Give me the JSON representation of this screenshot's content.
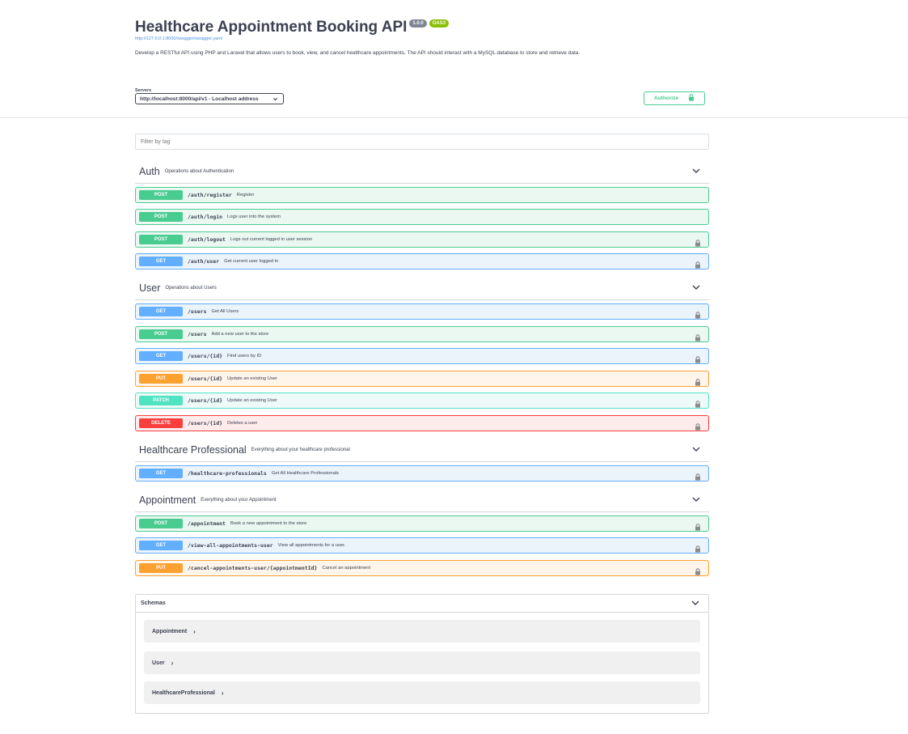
{
  "info": {
    "title": "Healthcare Appointment Booking API",
    "version": "1.0.0",
    "oas": "OAS3",
    "spec_url": "http://127.0.0.1:8000/swagger/swagger.yaml",
    "description": "Develop a RESTful API using PHP and Laravel that allows users to book, view, and cancel healthcare appointments. The API should interact with a MySQL database to store and retrieve data."
  },
  "servers": {
    "label": "Servers",
    "selected": "http://localhost:8000/api/v1 - Localhost address"
  },
  "authorize": {
    "label": "Authorize"
  },
  "filter": {
    "placeholder": "Filter by tag"
  },
  "tags": [
    {
      "name": "Auth",
      "description": "Operations about Authentication",
      "ops": [
        {
          "method": "POST",
          "path": "/auth/register",
          "summary": "Register",
          "locked": false
        },
        {
          "method": "POST",
          "path": "/auth/login",
          "summary": "Logs user into the system",
          "locked": false
        },
        {
          "method": "POST",
          "path": "/auth/logout",
          "summary": "Logs out current logged in user session",
          "locked": true
        },
        {
          "method": "GET",
          "path": "/auth/user",
          "summary": "Get current user logged in",
          "locked": true
        }
      ]
    },
    {
      "name": "User",
      "description": "Operations about Users",
      "ops": [
        {
          "method": "GET",
          "path": "/users",
          "summary": "Get All Users",
          "locked": true
        },
        {
          "method": "POST",
          "path": "/users",
          "summary": "Add a new user to the store",
          "locked": true
        },
        {
          "method": "GET",
          "path": "/users/{id}",
          "summary": "Find users by ID",
          "locked": true
        },
        {
          "method": "PUT",
          "path": "/users/{id}",
          "summary": "Update an existing User",
          "locked": true
        },
        {
          "method": "PATCH",
          "path": "/users/{id}",
          "summary": "Update an existing User",
          "locked": true
        },
        {
          "method": "DELETE",
          "path": "/users/{id}",
          "summary": "Deletes a user",
          "locked": true
        }
      ]
    },
    {
      "name": "Healthcare Professional",
      "description": "Everything about your healthcare professional",
      "ops": [
        {
          "method": "GET",
          "path": "/healthcare-professionals",
          "summary": "Get All Healthcare Professionals",
          "locked": true
        }
      ]
    },
    {
      "name": "Appointment",
      "description": "Everything about your Appointment",
      "ops": [
        {
          "method": "POST",
          "path": "/appointment",
          "summary": "Book a new appointment to the store",
          "locked": true
        },
        {
          "method": "GET",
          "path": "/view-all-appointments-user",
          "summary": "View all appointments for a user.",
          "locked": true
        },
        {
          "method": "PUT",
          "path": "/cancel-appointments-user/{appointmentId}",
          "summary": "Cancel an appointment",
          "locked": true
        }
      ]
    }
  ],
  "schemas": {
    "title": "Schemas",
    "models": [
      "Appointment",
      "User",
      "HealthcareProfessional"
    ]
  },
  "colors": {
    "post": "#49cc90",
    "get": "#61affe",
    "put": "#fca130",
    "patch": "#50e3c2",
    "delete": "#f93e3e"
  }
}
